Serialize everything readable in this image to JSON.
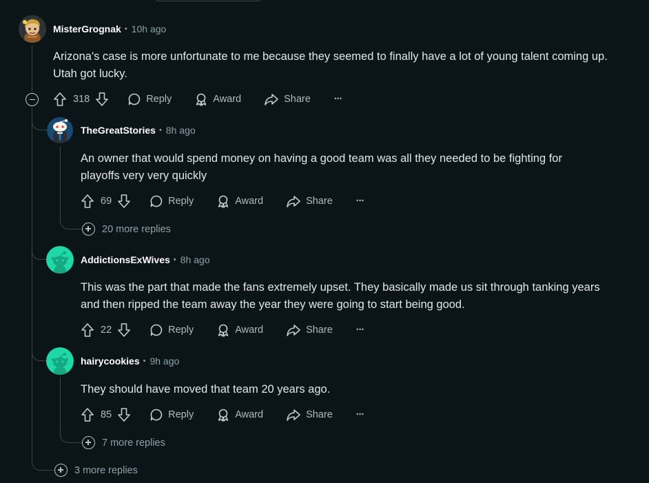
{
  "comments": [
    {
      "user": "MisterGrognak",
      "time": "10h ago",
      "lines": [
        "Arizona's case is more unfortunate to me because they seemed to finally have a lot of young talent coming up.",
        "Utah got lucky."
      ],
      "score": "318",
      "avatar_icon": "cartoon-character-avatar"
    },
    {
      "user": "TheGreatStories",
      "time": "8h ago",
      "lines": [
        "An owner that would spend money on having a good team was all they needed to be fighting for",
        "playoffs very very quickly"
      ],
      "score": "69",
      "avatar_icon": "snoo-avatar"
    },
    {
      "user": "AddictionsExWives",
      "time": "8h ago",
      "lines": [
        "This was the part that made the fans extremely upset. They basically made us sit through tanking years",
        "and then ripped the team away the year they were going to start being good."
      ],
      "score": "22",
      "avatar_icon": "default-snoo-avatar"
    },
    {
      "user": "hairycookies",
      "time": "9h ago",
      "lines": [
        "They should have moved that team 20 years ago."
      ],
      "score": "85",
      "avatar_icon": "default-snoo-avatar"
    }
  ],
  "actions": {
    "reply": "Reply",
    "award": "Award",
    "share": "Share",
    "more": "···"
  },
  "separator": "•",
  "more_replies": {
    "thegreatstories": "20 more replies",
    "hairycookies": "7 more replies",
    "root": "3 more replies"
  },
  "colors": {
    "background": "#0b1416",
    "thread_line": "#3a4346",
    "text_muted": "#8ba2ad",
    "snoo_teal": "#1fd8a8"
  }
}
